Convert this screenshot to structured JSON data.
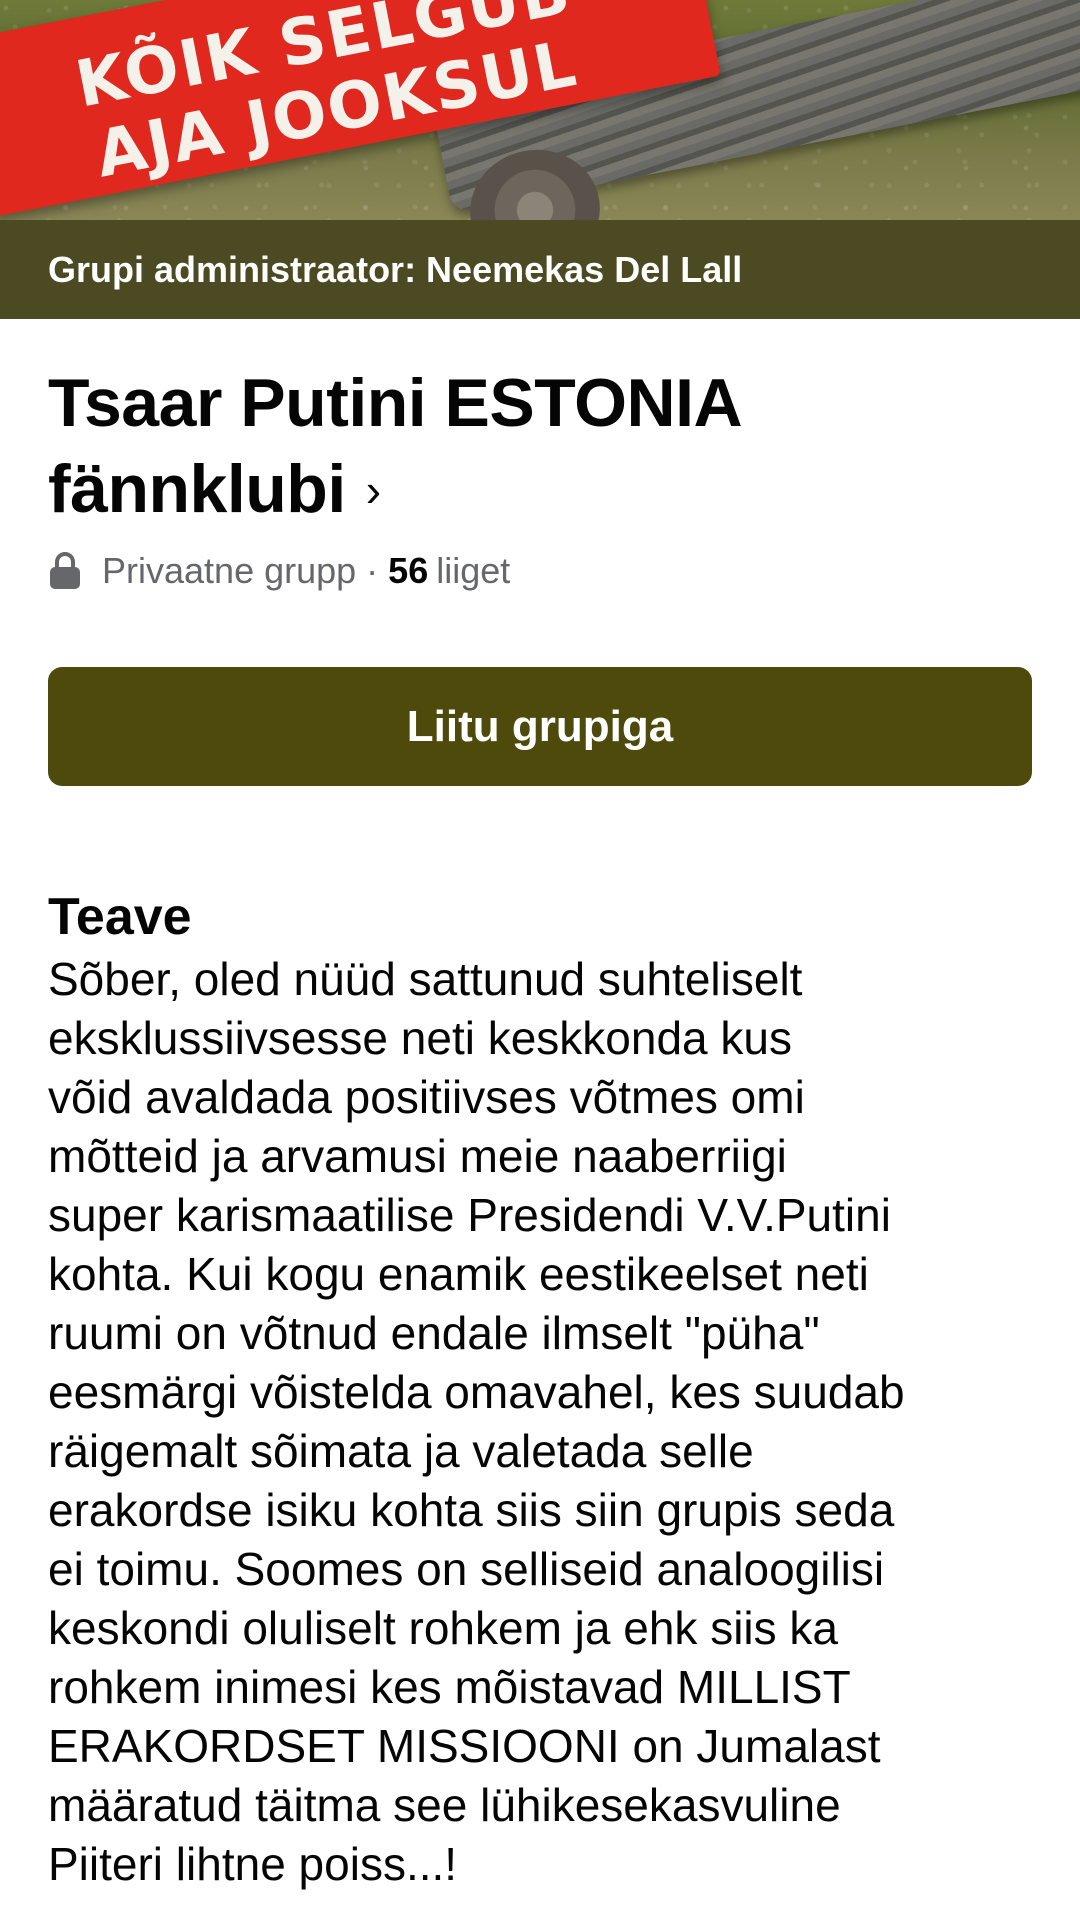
{
  "cover": {
    "sign_line_1": "KÕIK SELGUB",
    "sign_line_2": "AJA JOOKSUL"
  },
  "admin_bar": {
    "text": "Grupi administraator: Neemekas Del Lall"
  },
  "group": {
    "title": "Tsaar Putini ESTONIA fännklubi",
    "chevron": "›",
    "privacy": "Privaatne grupp",
    "separator": "·",
    "member_count": "56",
    "member_label": "liiget"
  },
  "join_button": {
    "label": "Liitu grupiga"
  },
  "about": {
    "heading": "Teave",
    "text": "Sõber, oled nüüd  sattunud suhteliselt\neksklussiivsesse neti keskkonda kus\nvõid avaldada positiivses võtmes omi\nmõtteid ja arvamusi meie naaberriigi\nsuper karismaatilise Presidendi V.V.Putini\nkohta.  Kui kogu enamik eestikeelset neti\nruumi on võtnud endale ilmselt \"püha\"\neesmärgi võistelda omavahel, kes suudab\nräigemalt sõimata ja valetada selle\nerakordse isiku kohta siis siin grupis seda\nei toimu. Soomes on selliseid analoogilisi\nkeskondi oluliselt rohkem ja ehk siis ka\nrohkem inimesi kes mõistavad MILLIST\nERAKORDSET MISSIOONI on Jumalast\nmääratud täitma see lühikesekasvuline\nPiiteri lihtne poiss...!"
  },
  "colors": {
    "admin_bar_bg": "#4b4a22",
    "join_button_bg": "#4d4a0c",
    "sign_red": "#e0281f",
    "secondary_text": "#65676b"
  },
  "icons": {
    "privacy": "lock-icon",
    "title_arrow": "chevron-right-icon"
  }
}
